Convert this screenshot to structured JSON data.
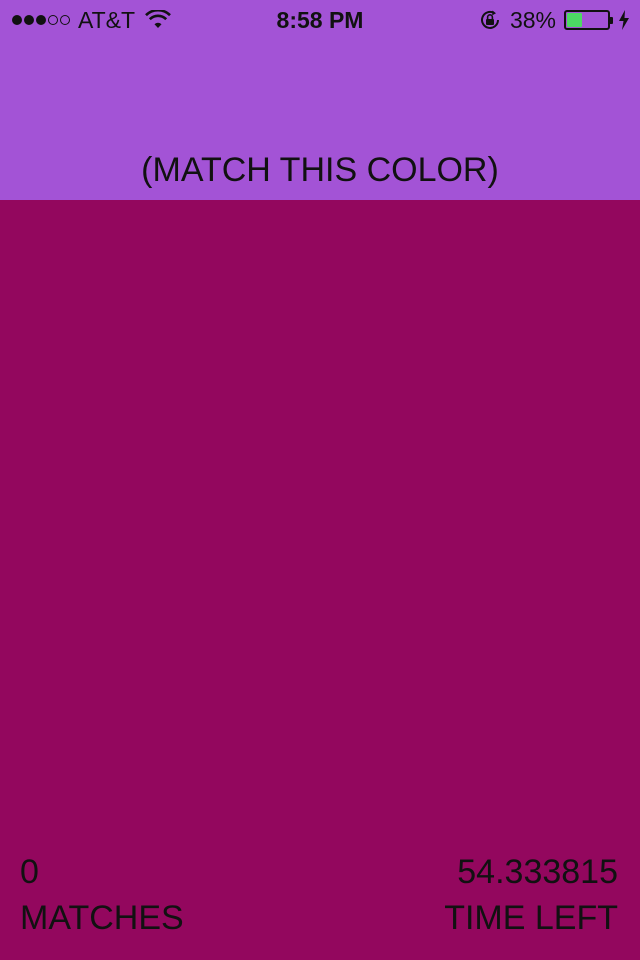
{
  "status_bar": {
    "signal_bars_filled": 3,
    "signal_bars_total": 5,
    "carrier": "AT&T",
    "time": "8:58 PM",
    "battery_percent_text": "38%",
    "battery_level": 0.38,
    "icons": [
      "wifi-icon",
      "rotation-lock-icon",
      "battery-icon",
      "charging-bolt-icon"
    ]
  },
  "target": {
    "prompt": "(MATCH THIS COLOR)",
    "color": "#a353d6"
  },
  "play_area": {
    "color": "#93075e"
  },
  "score": {
    "matches_value": "0",
    "matches_label": "MATCHES",
    "time_value": "54.333815",
    "time_label": "TIME LEFT"
  }
}
